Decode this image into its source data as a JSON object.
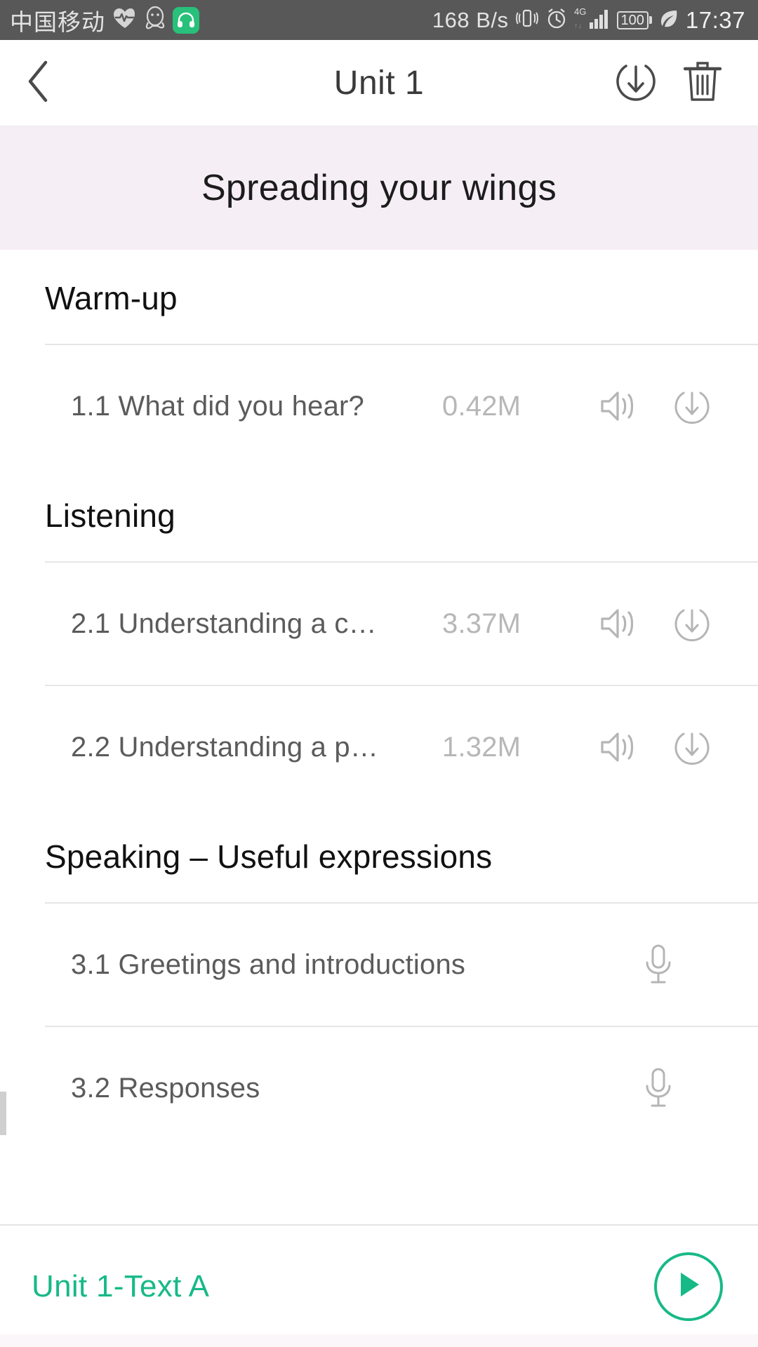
{
  "status_bar": {
    "carrier": "中国移动",
    "icons_left": [
      "heart-pulse-icon",
      "qq-penguin-icon",
      "headphones-app-icon"
    ],
    "net_speed": "168 B/s",
    "icons_right": [
      "vibrate-icon",
      "alarm-clock-icon",
      "signal-4g-icon",
      "battery-icon",
      "leaf-icon"
    ],
    "network_type": "4G",
    "battery_level": "100",
    "time": "17:37",
    "background_color": "#585858"
  },
  "nav_bar": {
    "back_icon": "chevron-left-icon",
    "title": "Unit 1",
    "download_all_icon": "download-circle-icon",
    "delete_icon": "trash-icon"
  },
  "banner": {
    "title": "Spreading your wings",
    "background_color": "#f6eef5"
  },
  "sections": [
    {
      "heading": "Warm-up",
      "rows": [
        {
          "label": "1.1 What did you hear?",
          "size": "0.42M",
          "icons": [
            "speaker-icon",
            "download-icon"
          ],
          "type": "audio"
        }
      ]
    },
    {
      "heading": "Listening",
      "rows": [
        {
          "label": "2.1 Understanding a c…",
          "size": "3.37M",
          "icons": [
            "speaker-icon",
            "download-icon"
          ],
          "type": "audio"
        },
        {
          "label": "2.2 Understanding a p…",
          "size": "1.32M",
          "icons": [
            "speaker-icon",
            "download-icon"
          ],
          "type": "audio"
        }
      ]
    },
    {
      "heading": "Speaking – Useful expressions",
      "rows": [
        {
          "label": "3.1 Greetings and introductions",
          "size": "",
          "icons": [
            "microphone-icon"
          ],
          "type": "record"
        },
        {
          "label": "3.2 Responses",
          "size": "",
          "icons": [
            "microphone-icon"
          ],
          "type": "record"
        }
      ]
    }
  ],
  "player": {
    "track_title": "Unit 1-Text A",
    "play_icon": "play-icon",
    "accent_color": "#17b987"
  }
}
